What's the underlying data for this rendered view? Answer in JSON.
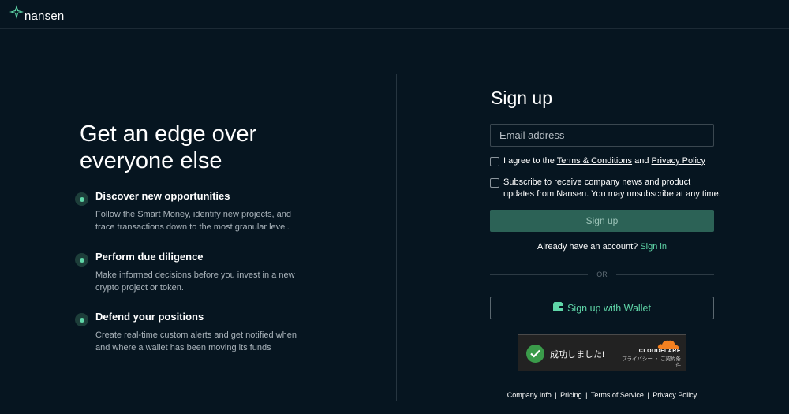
{
  "brand": {
    "name": "nansen",
    "accent": "#5fd6a8"
  },
  "hero": {
    "headline_line1": "Get an edge over",
    "headline_line2": "everyone else",
    "features": [
      {
        "title": "Discover new opportunities",
        "description": "Follow the Smart Money, identify new projects, and trace transactions down to the most granular level."
      },
      {
        "title": "Perform due diligence",
        "description": "Make informed decisions before you invest in a new crypto project or token."
      },
      {
        "title": "Defend your positions",
        "description": "Create real-time custom alerts and get notified when and where a wallet has been moving its funds"
      }
    ]
  },
  "form": {
    "title": "Sign up",
    "email_placeholder": "Email address",
    "email_value": "",
    "terms": {
      "prefix": "I agree to the ",
      "terms_link": "Terms & Conditions",
      "and": " and ",
      "privacy_link": "Privacy Policy",
      "checked": false
    },
    "subscribe": {
      "line1": "Subscribe to receive company news and product",
      "line2": "updates from Nansen. You may unsubscribe at any time.",
      "checked": false
    },
    "signup_button": "Sign up",
    "already_text": "Already have an account?",
    "signin_link": "Sign in",
    "or_label": "OR",
    "wallet_button": "Sign up with Wallet",
    "wallet_icon": "wallet-icon"
  },
  "captcha": {
    "status": "成功しました!",
    "brand": "CLOUDFLARE",
    "privacy": "プライバシー",
    "separator": "・",
    "terms": "ご契約条件",
    "status_color": "#3a9b4a"
  },
  "footer": {
    "links": [
      "Company Info",
      "Pricing",
      "Terms of Service",
      "Privacy Policy"
    ],
    "separator": "|"
  }
}
